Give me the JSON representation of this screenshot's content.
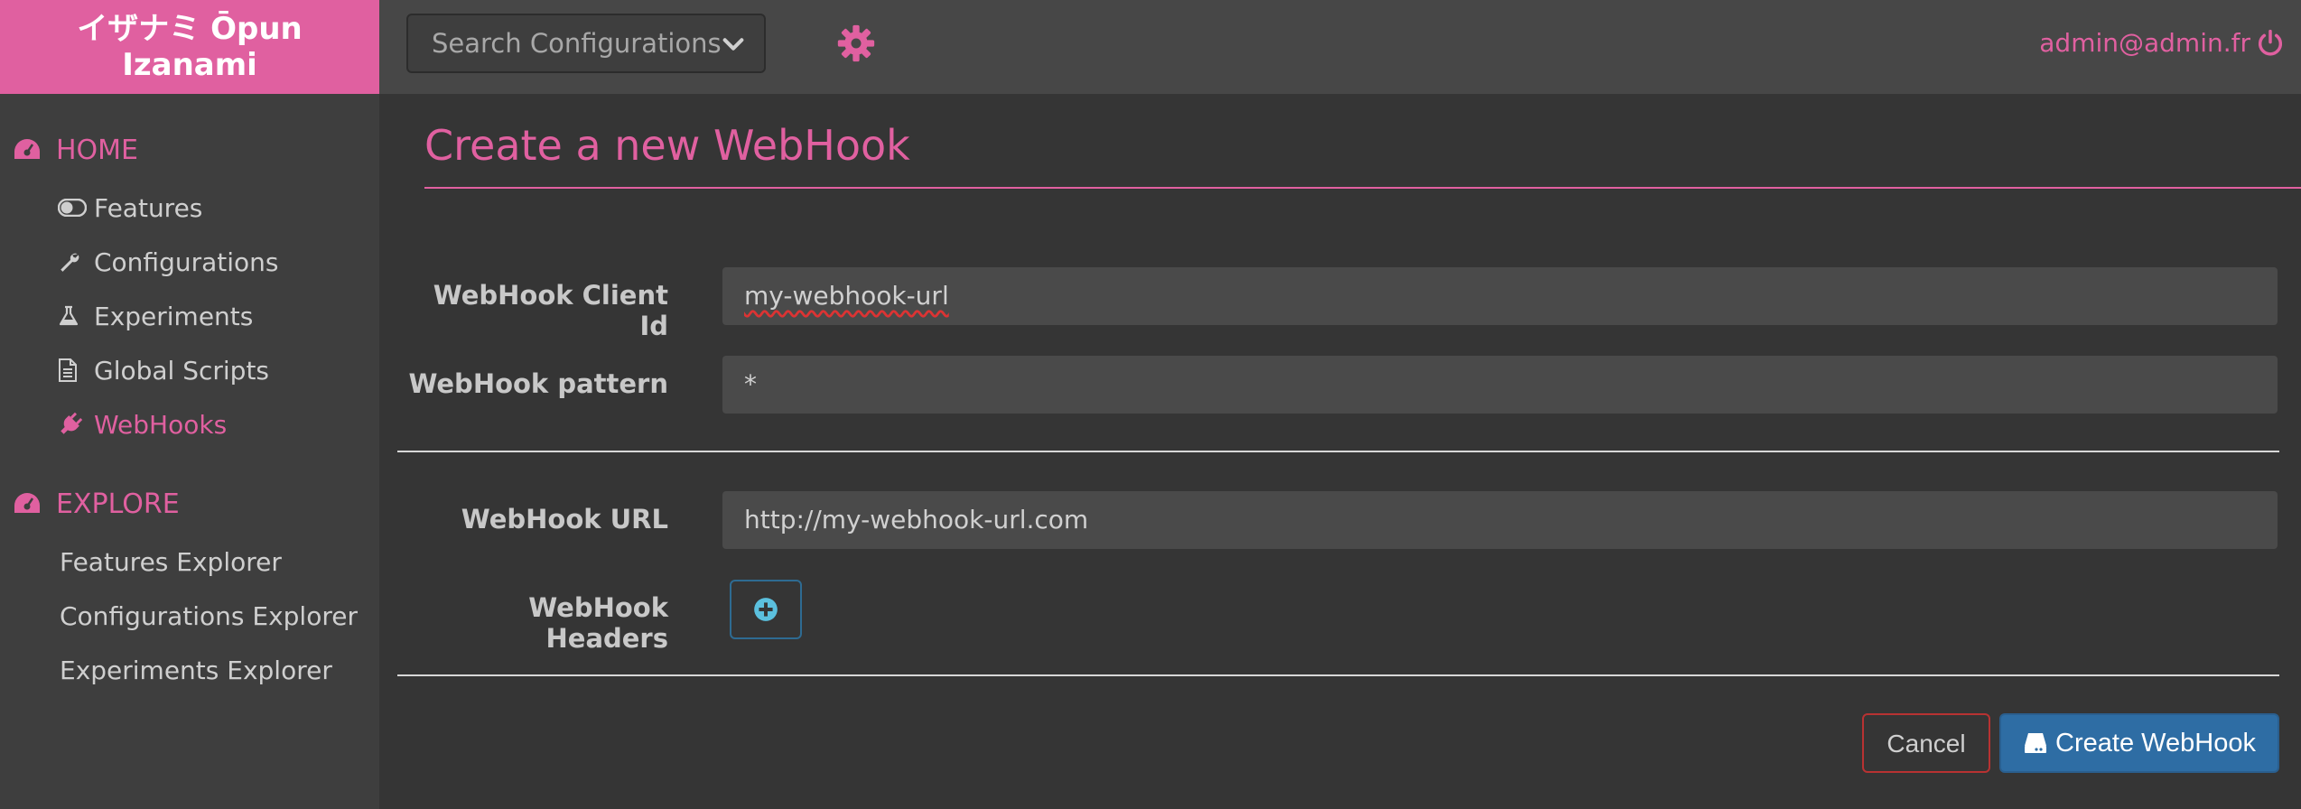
{
  "brand": {
    "line1": "イザナミ Ōpun",
    "line2": "Izanami"
  },
  "header": {
    "search_placeholder": "Search Configurations",
    "user": "admin@admin.fr"
  },
  "sidebar": {
    "home": "HOME",
    "items": [
      {
        "label": "Features",
        "icon": "toggle-icon"
      },
      {
        "label": "Configurations",
        "icon": "wrench-icon"
      },
      {
        "label": "Experiments",
        "icon": "flask-icon"
      },
      {
        "label": "Global Scripts",
        "icon": "file-icon"
      },
      {
        "label": "WebHooks",
        "icon": "plug-icon",
        "active": true
      }
    ],
    "explore": "EXPLORE",
    "explore_items": [
      {
        "label": "Features Explorer"
      },
      {
        "label": "Configurations Explorer"
      },
      {
        "label": "Experiments Explorer"
      }
    ]
  },
  "form": {
    "title": "Create a new WebHook",
    "client_id_label": "WebHook Client Id",
    "client_id_value": "my-webhook-url",
    "pattern_label": "WebHook pattern",
    "pattern_value": "*",
    "url_label": "WebHook URL",
    "url_value": "http://my-webhook-url.com",
    "headers_label": "WebHook Headers"
  },
  "actions": {
    "cancel": "Cancel",
    "create": "Create WebHook"
  },
  "colors": {
    "accent": "#e060a0",
    "primary": "#2e6da4",
    "danger": "#b83232"
  }
}
